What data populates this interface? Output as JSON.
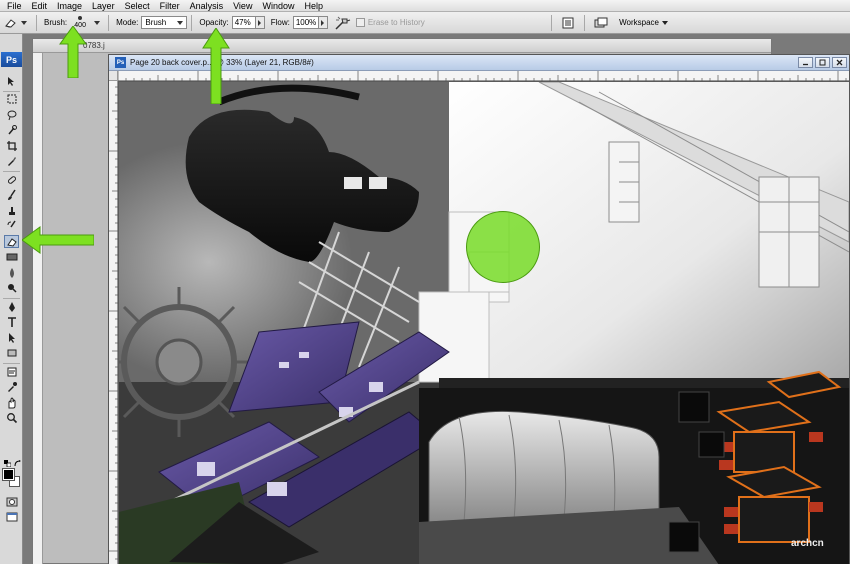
{
  "menu": [
    "File",
    "Edit",
    "Image",
    "Layer",
    "Select",
    "Filter",
    "Analysis",
    "View",
    "Window",
    "Help"
  ],
  "options_bar": {
    "tool_preset_icon": "eraser-icon",
    "brush_label": "Brush:",
    "brush_size": "400",
    "mode_label": "Mode:",
    "mode_value": "Brush",
    "opacity_label": "Opacity:",
    "opacity_value": "47%",
    "flow_label": "Flow:",
    "flow_value": "100%",
    "airbrush_icon": "airbrush-icon",
    "erase_to_history_label": "Erase to History",
    "workspace_label": "Workspace"
  },
  "toolbox": {
    "logo": "Ps",
    "tools": [
      "move-tool-icon",
      "marquee-tool-icon",
      "lasso-tool-icon",
      "quick-select-tool-icon",
      "crop-tool-icon",
      "eyedropper-tool-icon",
      "healing-brush-tool-icon",
      "brush-tool-icon",
      "clone-stamp-tool-icon",
      "history-brush-tool-icon",
      "eraser-tool-icon",
      "gradient-tool-icon",
      "blur-tool-icon",
      "dodge-tool-icon",
      "pen-tool-icon",
      "type-tool-icon",
      "path-select-tool-icon",
      "shape-tool-icon",
      "notes-tool-icon",
      "eyedropper-3d-icon",
      "hand-tool-icon",
      "zoom-tool-icon"
    ],
    "active_tool": "eraser-tool-icon",
    "foreground_color": "#000000",
    "background_color": "#ffffff"
  },
  "documents": {
    "back_title": "0783.j",
    "front_title": "Page 20 back cover.p... @ 33% (Layer 21, RGB/8#)"
  },
  "annotation_color": "#7de021",
  "watermark": "archcn"
}
